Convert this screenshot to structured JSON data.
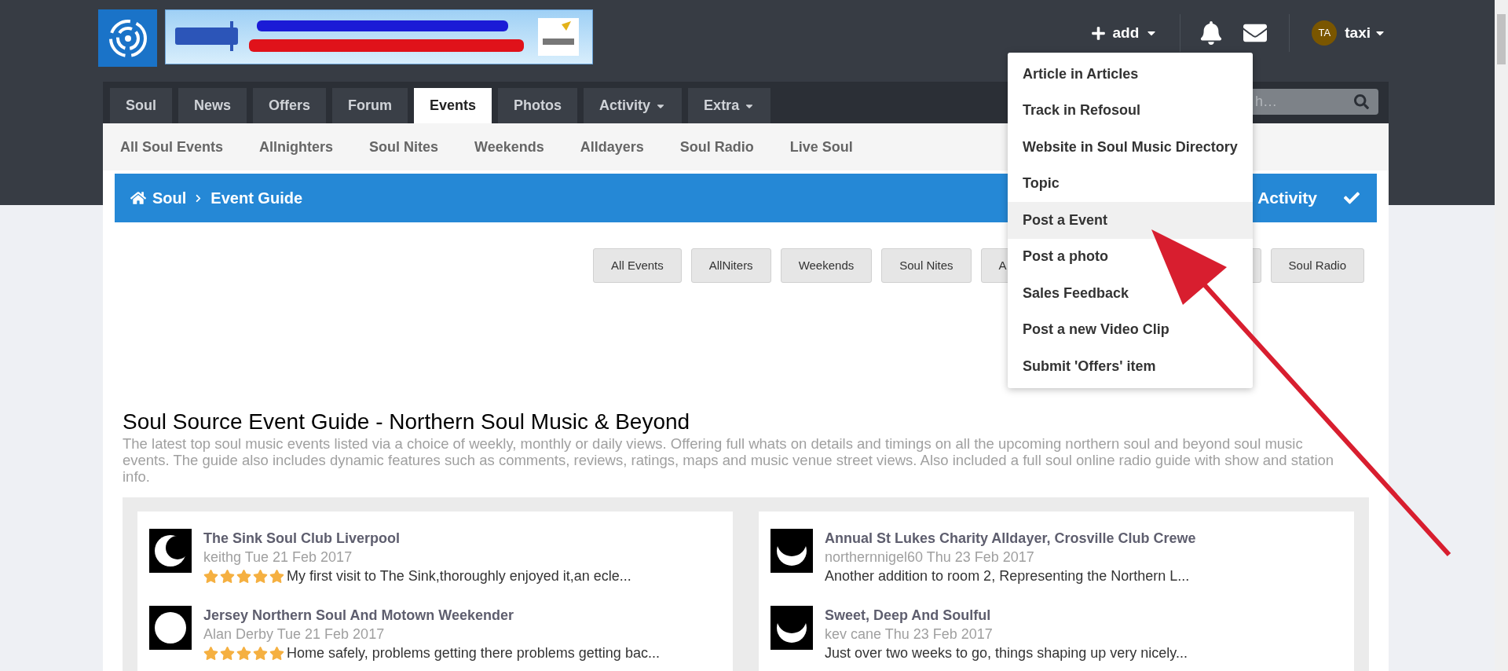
{
  "header": {
    "add_label": "add",
    "user_initials": "TA",
    "user_name": "taxi"
  },
  "tabs": [
    {
      "label": "Soul",
      "selected": false,
      "dropdown": false
    },
    {
      "label": "News",
      "selected": false,
      "dropdown": false
    },
    {
      "label": "Offers",
      "selected": false,
      "dropdown": false
    },
    {
      "label": "Forum",
      "selected": false,
      "dropdown": false
    },
    {
      "label": "Events",
      "selected": true,
      "dropdown": false
    },
    {
      "label": "Photos",
      "selected": false,
      "dropdown": false
    },
    {
      "label": "Activity",
      "selected": false,
      "dropdown": true
    },
    {
      "label": "Extra",
      "selected": false,
      "dropdown": true
    }
  ],
  "search": {
    "placeholder": "h…"
  },
  "subnav": [
    "All Soul Events",
    "Allnighters",
    "Soul Nites",
    "Weekends",
    "Alldayers",
    "Soul Radio",
    "Live Soul"
  ],
  "breadcrumb": [
    "Soul",
    "Event Guide"
  ],
  "activity_label": "Activity",
  "filters": [
    "All Events",
    "AllNiters",
    "Weekends",
    "Soul Nites",
    "A",
    "Soul Radio"
  ],
  "heading": "Soul Source Event Guide - Northern Soul Music & Beyond",
  "intro": "The latest top soul music events listed via a choice of weekly, monthly or daily views. Offering full whats on details and timings on all the upcoming northern soul and beyond soul music events.  The guide also includes dynamic features such as comments, reviews, ratings, maps and music venue street views.  Also included a full soul online radio guide with show and station info.",
  "columns": [
    [
      {
        "kind": "crescent",
        "title": "The Sink Soul Club Liverpool",
        "meta": "keithg Tue 21 Feb 2017",
        "stars": 5,
        "text": "My first visit to The Sink,thoroughly enjoyed it,an ecle..."
      },
      {
        "kind": "full",
        "title": "Jersey Northern Soul And Motown Weekender",
        "meta": "Alan Derby Tue 21 Feb 2017",
        "stars": 5,
        "text": "Home safely, problems getting there problems getting bac..."
      }
    ],
    [
      {
        "kind": "bowl",
        "title": "Annual St Lukes Charity Alldayer, Crosville Club Crewe",
        "meta": "northernnigel60 Thu 23 Feb 2017",
        "text": "Another addition to room 2,  Representing the Northern L..."
      },
      {
        "kind": "bowl",
        "title": "Sweet, Deep And Soulful",
        "meta": "kev cane Thu 23 Feb 2017",
        "text": "Just over two weeks to go, things shaping up very nicely..."
      }
    ]
  ],
  "add_menu": [
    {
      "label": "Article in Articles",
      "selected": false
    },
    {
      "label": "Track in Refosoul",
      "selected": false
    },
    {
      "label": "Website in Soul Music Directory",
      "selected": false
    },
    {
      "label": "Topic",
      "selected": false
    },
    {
      "label": "Post a Event",
      "selected": true
    },
    {
      "label": "Post a photo",
      "selected": false
    },
    {
      "label": "Sales Feedback",
      "selected": false
    },
    {
      "label": "Post a new Video Clip",
      "selected": false
    },
    {
      "label": "Submit 'Offers' item",
      "selected": false
    }
  ]
}
